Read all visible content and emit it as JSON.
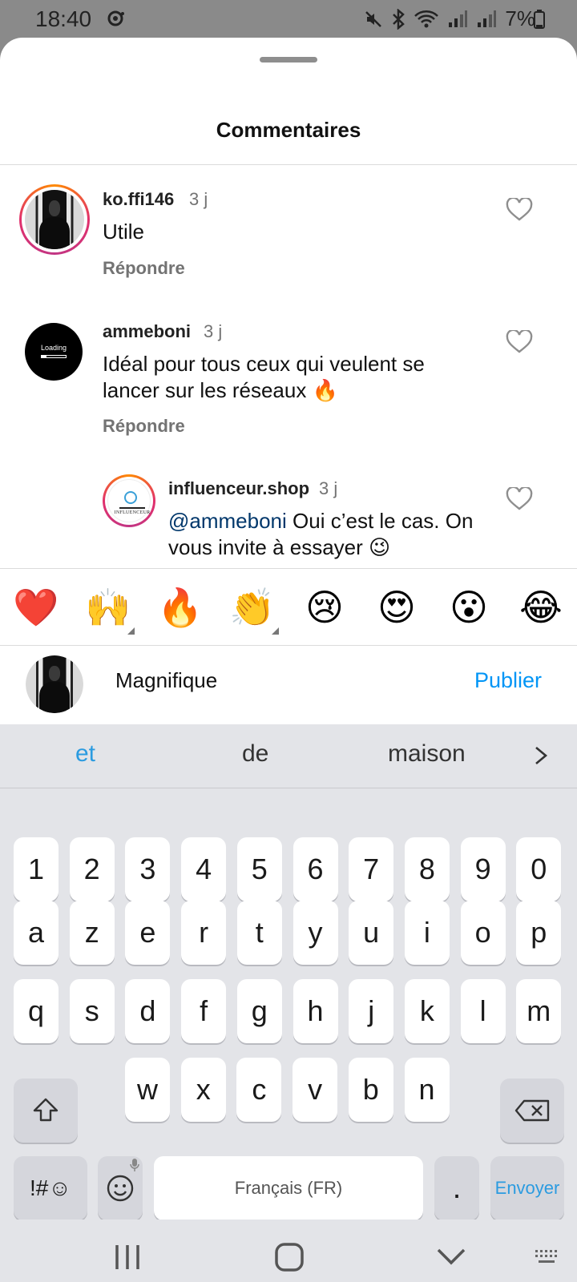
{
  "status_bar": {
    "time": "18:40",
    "battery": "7%"
  },
  "sheet": {
    "title": "Commentaires"
  },
  "comments": [
    {
      "username": "ko.ffi146",
      "time": "3 j",
      "text": "Utile",
      "reply_label": "Répondre"
    },
    {
      "username": "ammeboni",
      "time": "3 j",
      "text_line1": "Idéal pour tous ceux qui veulent se",
      "text_line2": "lancer sur les réseaux 🔥",
      "reply_label": "Répondre",
      "avatar_text": "Loading"
    },
    {
      "username": "influenceur.shop",
      "time": "3 j",
      "mention": "@ammeboni",
      "text_line1": " Oui c’est le cas. On",
      "text_line2": "vous invite à essayer 😉",
      "avatar_text": "INFLUENCEUR"
    }
  ],
  "emoji_bar": [
    "❤️",
    "🙌",
    "🔥",
    "👏",
    "😢",
    "😍",
    "😮",
    "😂"
  ],
  "composer": {
    "value": "Magnifique",
    "publish_label": "Publier"
  },
  "keyboard": {
    "suggestions": [
      "et",
      "de",
      "maison"
    ],
    "row_numbers": [
      "1",
      "2",
      "3",
      "4",
      "5",
      "6",
      "7",
      "8",
      "9",
      "0"
    ],
    "row1": [
      "a",
      "z",
      "e",
      "r",
      "t",
      "y",
      "u",
      "i",
      "o",
      "p"
    ],
    "row2": [
      "q",
      "s",
      "d",
      "f",
      "g",
      "h",
      "j",
      "k",
      "l",
      "m"
    ],
    "row3": [
      "w",
      "x",
      "c",
      "v",
      "b",
      "n"
    ],
    "symbols_label": "!#☺",
    "space_label": "Français (FR)",
    "period_label": ".",
    "send_label": "Envoyer"
  },
  "icons": {
    "heart": "heart-outline-icon",
    "shift": "shift-icon",
    "backspace": "backspace-icon",
    "emoji": "smiley-icon"
  }
}
